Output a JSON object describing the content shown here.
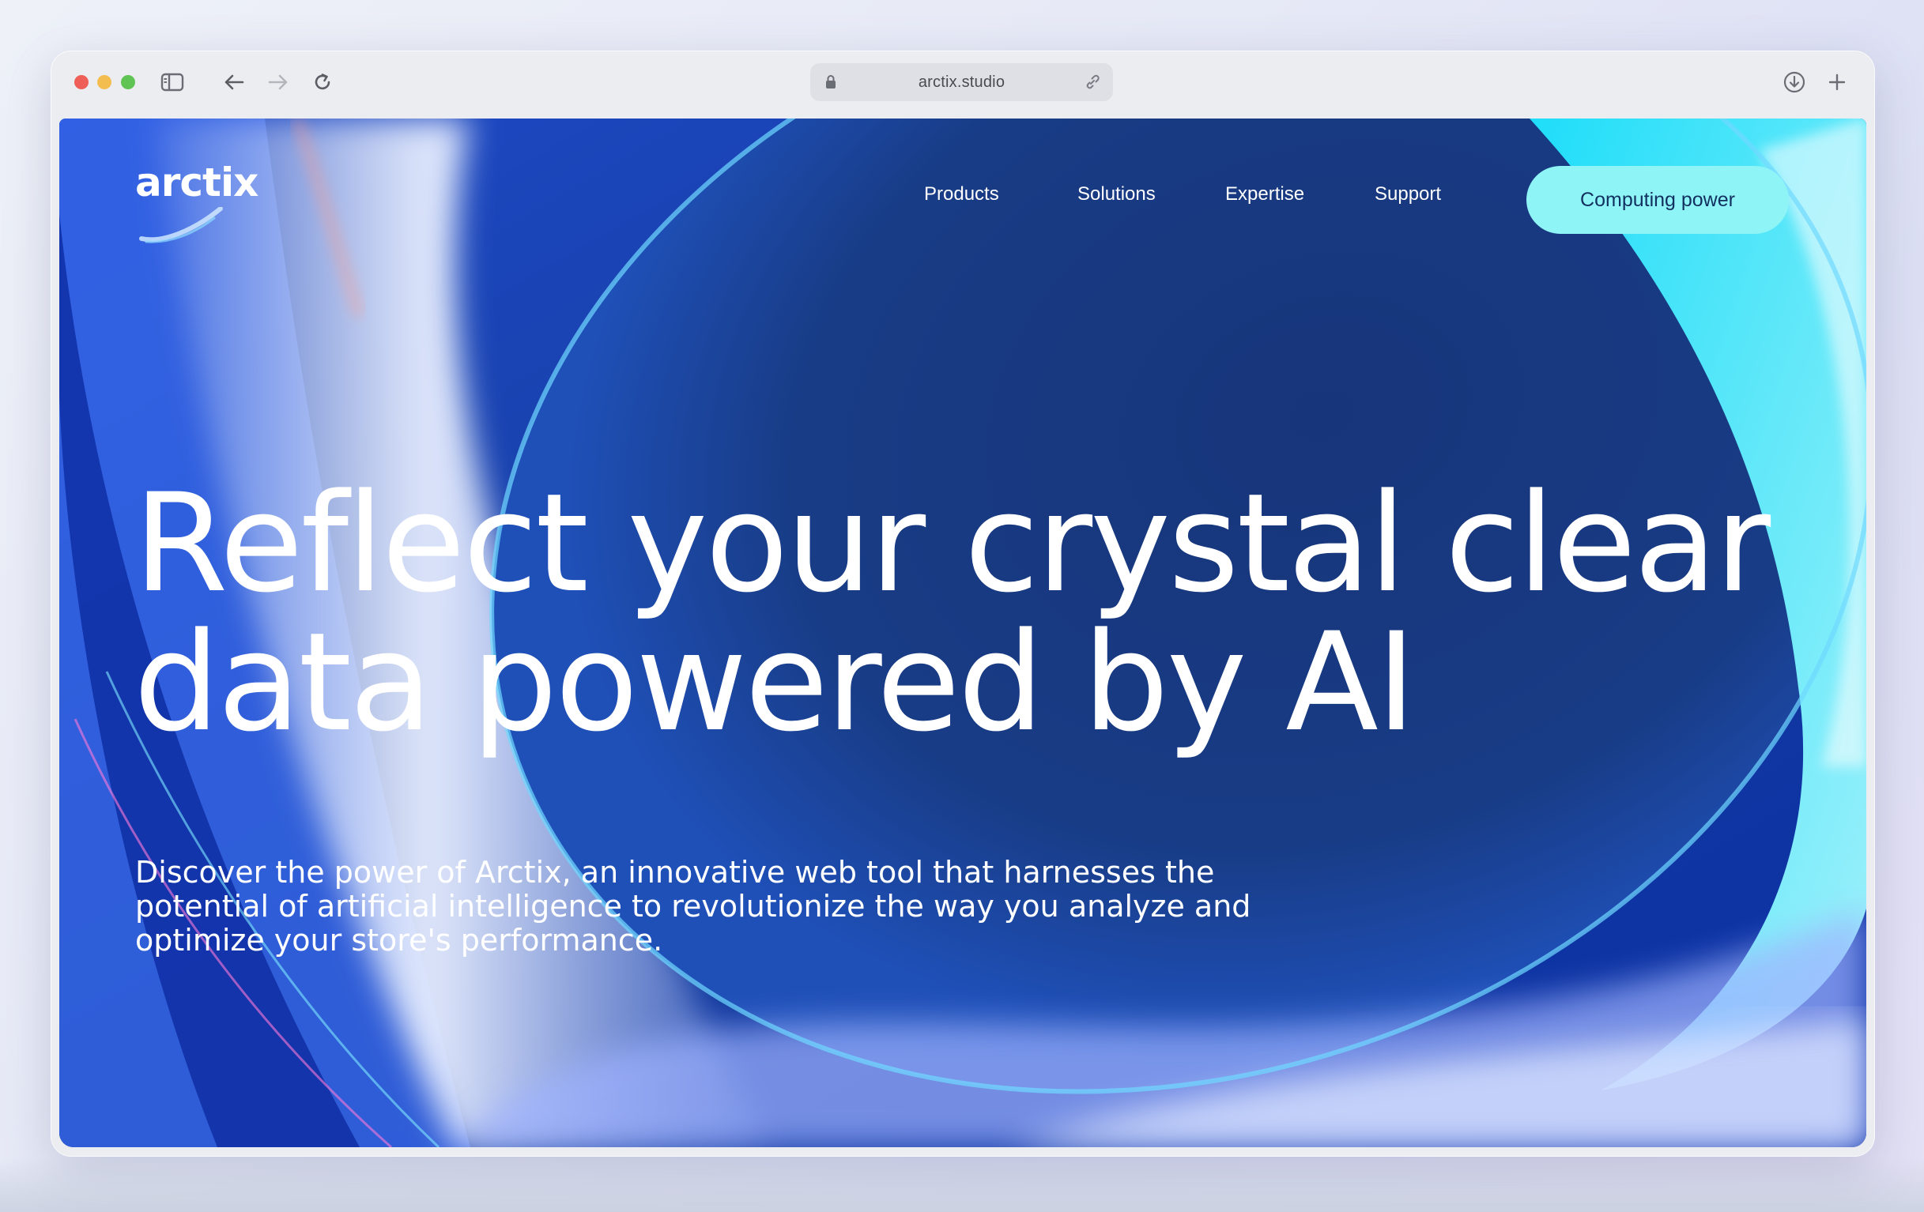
{
  "browser": {
    "url": "arctix.studio"
  },
  "site": {
    "logo_text": "arctix",
    "nav": [
      {
        "label": "Products"
      },
      {
        "label": "Solutions"
      },
      {
        "label": "Expertise"
      },
      {
        "label": "Support"
      }
    ],
    "cta_label": "Computing power"
  },
  "hero": {
    "line1": "Reflect your crystal clear",
    "line2": "data powered by AI",
    "description": "Discover the power of Arctix, an innovative web tool that harnesses the potential of artificial intelligence to revolutionize the way you analyze and optimize your store's performance."
  },
  "colors": {
    "accent": "#8ff4f6",
    "background_deep": "#123a8a",
    "text": "#ffffff"
  },
  "icons": [
    "sidebar-toggle-icon",
    "back-arrow-icon",
    "forward-arrow-icon",
    "reload-icon",
    "lock-icon",
    "link-icon",
    "download-icon",
    "plus-icon"
  ]
}
